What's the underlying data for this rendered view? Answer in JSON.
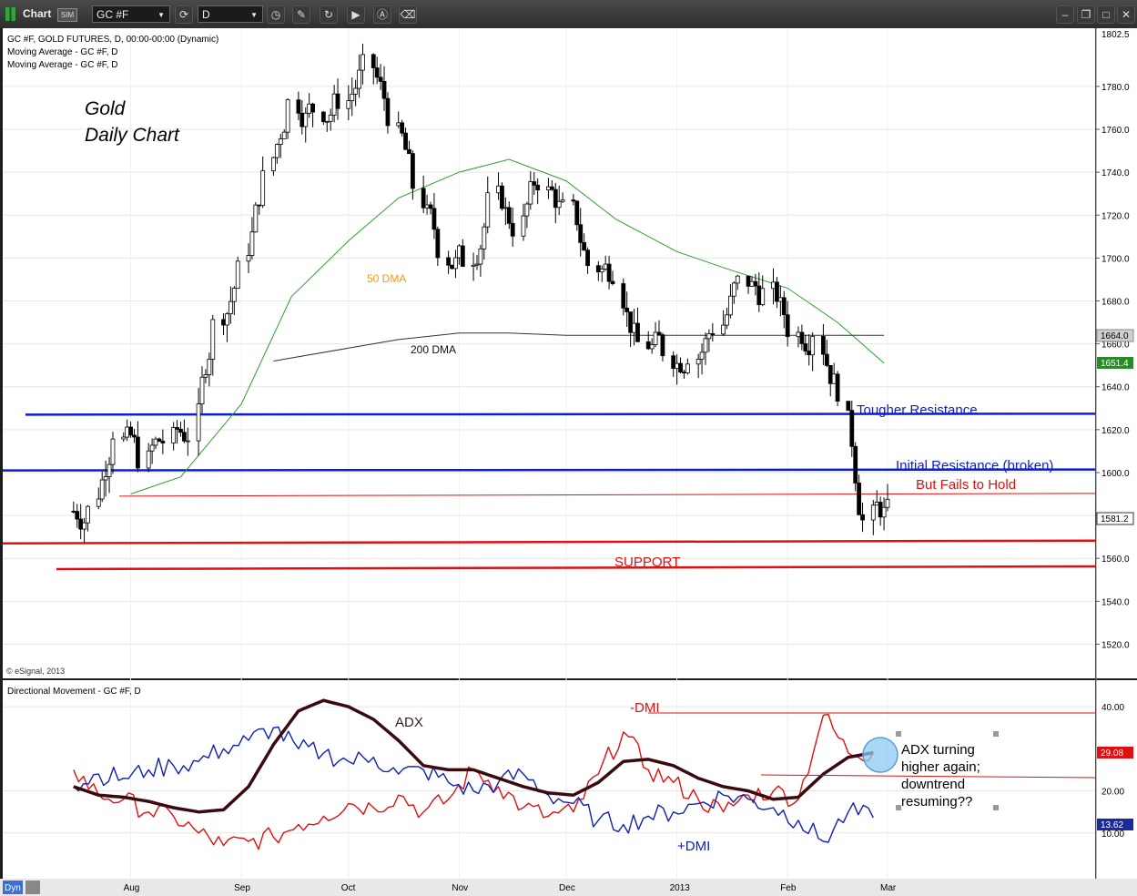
{
  "toolbar": {
    "app_label": "Chart",
    "sim_badge": "SIM",
    "symbol": "GC #F",
    "interval": "D",
    "icons": [
      "chart-bars-icon",
      "dropdown-arrow-icon",
      "link-cycle-icon",
      "dropdown-arrow-icon",
      "clock-icon",
      "pencil-icon",
      "refresh-icon",
      "play-icon",
      "a-circle-icon",
      "eraser-icon",
      "minimize-icon",
      "restore-icon",
      "maximize-icon",
      "close-icon"
    ]
  },
  "price_panel": {
    "study_labels": [
      "GC #F, GOLD FUTURES, D, 00:00-00:00 (Dynamic)",
      "Moving Average - GC #F, D",
      "Moving Average - GC #F, D"
    ],
    "chart_title_line1": "Gold",
    "chart_title_line2": "Daily Chart",
    "copyright": "© eSignal, 2013",
    "axis_ticks": [
      "1780.0",
      "1760.0",
      "1740.0",
      "1720.0",
      "1700.0",
      "1680.0",
      "1660.0",
      "1640.0",
      "1620.0",
      "1600.0",
      "1580.0",
      "1560.0",
      "1540.0",
      "1520.0"
    ],
    "axis_top_value": "1802.5",
    "badge_200dma": "1664.0",
    "badge_50dma": "1651.4",
    "badge_last": "1581.2",
    "annotations": {
      "dma50": "50 DMA",
      "dma200": "200 DMA",
      "tougher_resistance": "Tougher Resistance",
      "initial_resistance": "Initial Resistance (broken)",
      "fails_to_hold": "But Fails to Hold",
      "support": "SUPPORT"
    }
  },
  "dmi_panel": {
    "study_label": "Directional Movement - GC #F, D",
    "axis_ticks": [
      "40.00",
      "20.00",
      "10.00"
    ],
    "badge_adx": "29.08",
    "badge_pdmi": "13.62",
    "labels": {
      "adx": "ADX",
      "mdmi": "-DMI",
      "pdmi": "+DMI"
    },
    "note_lines": [
      "ADX turning",
      "higher again;",
      "downtrend",
      "resuming??"
    ]
  },
  "x_axis": {
    "months": [
      "Aug",
      "Sep",
      "Oct",
      "Nov",
      "Dec",
      "2013",
      "Feb",
      "Mar"
    ]
  },
  "corner_label": "Dyn",
  "colors": {
    "up_candle": "#ffffff",
    "down_candle": "#000000",
    "dma50": "#2ca02c",
    "dma200": "#333333",
    "resistance": "#0a1ed2",
    "support": "#e01010",
    "adx": "#3a0a10",
    "mdmi": "#e01010",
    "pdmi": "#1020b0",
    "badge_50dma": "#2a8a2a",
    "badge_adx": "#e01010",
    "badge_pdmi": "#1a2a9a"
  },
  "chart_data": [
    {
      "type": "candlestick",
      "title": "GC #F, GOLD FUTURES, D",
      "x": [
        "2012-07-16",
        "2012-07-23",
        "2012-07-30",
        "2012-08-06",
        "2012-08-13",
        "2012-08-20",
        "2012-08-27",
        "2012-09-03",
        "2012-09-10",
        "2012-09-17",
        "2012-09-24",
        "2012-10-01",
        "2012-10-08",
        "2012-10-15",
        "2012-10-22",
        "2012-10-29",
        "2012-11-05",
        "2012-11-12",
        "2012-11-19",
        "2012-11-26",
        "2012-12-03",
        "2012-12-10",
        "2012-12-17",
        "2012-12-24",
        "2012-12-31",
        "2013-01-07",
        "2013-01-14",
        "2013-01-21",
        "2013-01-28",
        "2013-02-04",
        "2013-02-11",
        "2013-02-18",
        "2013-02-25"
      ],
      "close": [
        1582,
        1620,
        1608,
        1615,
        1618,
        1668,
        1693,
        1736,
        1772,
        1770,
        1775,
        1788,
        1768,
        1734,
        1706,
        1700,
        1725,
        1715,
        1737,
        1722,
        1697,
        1695,
        1660,
        1658,
        1656,
        1668,
        1688,
        1683,
        1668,
        1667,
        1640,
        1577,
        1581
      ],
      "ylim": [
        1510,
        1805
      ],
      "series": [
        {
          "name": "50 DMA",
          "x": [
            "2012-08-01",
            "2012-08-15",
            "2012-09-01",
            "2012-09-15",
            "2012-10-01",
            "2012-10-15",
            "2012-11-01",
            "2012-11-15",
            "2012-12-01",
            "2012-12-15",
            "2013-01-01",
            "2013-01-15",
            "2013-02-01",
            "2013-02-15",
            "2013-02-28"
          ],
          "values": [
            1590,
            1598,
            1632,
            1682,
            1708,
            1728,
            1740,
            1746,
            1736,
            1718,
            1703,
            1695,
            1686,
            1670,
            1651
          ]
        },
        {
          "name": "200 DMA",
          "x": [
            "2012-09-10",
            "2012-10-01",
            "2012-10-15",
            "2012-11-01",
            "2012-11-15",
            "2012-12-01",
            "2012-12-15",
            "2013-01-01",
            "2013-01-15",
            "2013-02-01",
            "2013-02-28"
          ],
          "values": [
            1652,
            1658,
            1662,
            1665,
            1665,
            1664,
            1664,
            1664,
            1664,
            1664,
            1664
          ]
        }
      ],
      "levels": [
        {
          "name": "Tougher Resistance",
          "y": 1627
        },
        {
          "name": "Initial Resistance (broken)",
          "y": 1601
        },
        {
          "name": "But Fails to Hold",
          "y": 1589
        },
        {
          "name": "SUPPORT",
          "y": 1567
        },
        {
          "name": "SUPPORT",
          "y": 1555
        }
      ],
      "last_value": 1581.2
    },
    {
      "type": "line",
      "title": "Directional Movement - GC #F, D",
      "x": [
        "2012-07-16",
        "2012-07-23",
        "2012-07-30",
        "2012-08-06",
        "2012-08-13",
        "2012-08-20",
        "2012-08-27",
        "2012-09-03",
        "2012-09-10",
        "2012-09-17",
        "2012-09-24",
        "2012-10-01",
        "2012-10-08",
        "2012-10-15",
        "2012-10-22",
        "2012-10-29",
        "2012-11-05",
        "2012-11-12",
        "2012-11-19",
        "2012-11-26",
        "2012-12-03",
        "2012-12-10",
        "2012-12-17",
        "2012-12-24",
        "2012-12-31",
        "2013-01-07",
        "2013-01-14",
        "2013-01-21",
        "2013-01-28",
        "2013-02-04",
        "2013-02-11",
        "2013-02-18",
        "2013-02-25"
      ],
      "series": [
        {
          "name": "ADX",
          "values": [
            21,
            19,
            18.5,
            17.5,
            16,
            15,
            15.5,
            21,
            31,
            39,
            41.5,
            40,
            37,
            32,
            26,
            25,
            25,
            23,
            21,
            19.5,
            19,
            22,
            27,
            27.5,
            26,
            23,
            21,
            20,
            18,
            18.5,
            24,
            28,
            29.08
          ]
        },
        {
          "name": "-DMI",
          "values": [
            25,
            19,
            18,
            15,
            14,
            10,
            7,
            8,
            9,
            12,
            14,
            17,
            16,
            19,
            15,
            18,
            25,
            21,
            16,
            14,
            15,
            24,
            34,
            25,
            22,
            18,
            15,
            19,
            20,
            18,
            38,
            29,
            29.08
          ]
        },
        {
          "name": "+DMI",
          "values": [
            21,
            24,
            23,
            25,
            26,
            27,
            30,
            32,
            35,
            30,
            29,
            27,
            28,
            24,
            25,
            22,
            20,
            22,
            24,
            19,
            17,
            13,
            12,
            14,
            15,
            17,
            19,
            18,
            16,
            13,
            8,
            15,
            13.62
          ]
        }
      ],
      "ylim": [
        0,
        45
      ]
    }
  ]
}
